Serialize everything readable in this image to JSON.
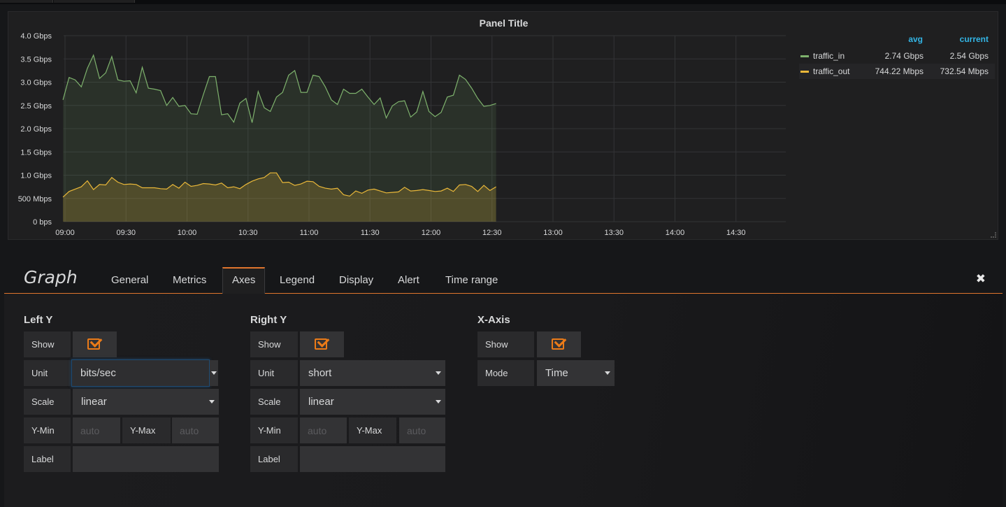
{
  "panel": {
    "title": "Panel Title",
    "legend": {
      "headers": {
        "avg": "avg",
        "current": "current"
      },
      "rows": [
        {
          "name": "traffic_in",
          "avg": "2.74 Gbps",
          "current": "2.54 Gbps",
          "color": "#7eb26d"
        },
        {
          "name": "traffic_out",
          "avg": "744.22 Mbps",
          "current": "732.54 Mbps",
          "color": "#eab839"
        }
      ]
    }
  },
  "chart_data": {
    "type": "area",
    "title": "Panel Title",
    "y_tick_labels": [
      "0 bps",
      "500 Mbps",
      "1.0 Gbps",
      "1.5 Gbps",
      "2.0 Gbps",
      "2.5 Gbps",
      "3.0 Gbps",
      "3.5 Gbps",
      "4.0 Gbps"
    ],
    "x_tick_labels": [
      "09:00",
      "09:30",
      "10:00",
      "10:30",
      "11:00",
      "11:30",
      "12:00",
      "12:30",
      "13:00",
      "13:30",
      "14:00",
      "14:30"
    ],
    "ylim_gbps": [
      0,
      4
    ],
    "x_range_minutes_after_0900": [
      -1,
      178
    ],
    "grid": true,
    "legend_position": "right",
    "series": [
      {
        "name": "traffic_in",
        "color": "#7eb26d",
        "points": [
          [
            -1,
            2.62
          ],
          [
            2,
            3.1
          ],
          [
            5,
            3.05
          ],
          [
            8,
            2.9
          ],
          [
            11,
            3.3
          ],
          [
            14,
            3.58
          ],
          [
            17,
            3.08
          ],
          [
            20,
            3.2
          ],
          [
            23,
            3.55
          ],
          [
            26,
            3.05
          ],
          [
            29,
            3.02
          ],
          [
            32,
            3.03
          ],
          [
            35,
            2.77
          ],
          [
            38,
            3.32
          ],
          [
            41,
            2.87
          ],
          [
            44,
            2.85
          ],
          [
            47,
            2.82
          ],
          [
            50,
            2.5
          ],
          [
            53,
            2.67
          ],
          [
            56,
            2.48
          ],
          [
            59,
            2.5
          ],
          [
            62,
            2.32
          ],
          [
            65,
            2.31
          ],
          [
            68,
            2.73
          ],
          [
            71,
            3.12
          ],
          [
            74,
            3.12
          ],
          [
            77,
            2.3
          ],
          [
            80,
            2.32
          ],
          [
            83,
            2.14
          ],
          [
            86,
            2.55
          ],
          [
            89,
            2.65
          ],
          [
            92,
            2.13
          ],
          [
            95,
            2.8
          ],
          [
            98,
            2.45
          ],
          [
            101,
            2.37
          ],
          [
            104,
            2.68
          ],
          [
            107,
            2.78
          ],
          [
            110,
            3.15
          ],
          [
            113,
            3.25
          ],
          [
            116,
            2.78
          ],
          [
            119,
            2.78
          ],
          [
            122,
            3.15
          ],
          [
            125,
            3.12
          ],
          [
            128,
            2.9
          ],
          [
            131,
            2.62
          ],
          [
            134,
            2.52
          ],
          [
            137,
            2.85
          ],
          [
            140,
            2.76
          ],
          [
            143,
            2.76
          ],
          [
            146,
            2.85
          ],
          [
            149,
            2.68
          ],
          [
            152,
            2.52
          ],
          [
            155,
            2.66
          ],
          [
            158,
            2.23
          ],
          [
            161,
            2.49
          ],
          [
            164,
            2.58
          ],
          [
            167,
            2.6
          ],
          [
            170,
            2.25
          ],
          [
            173,
            2.36
          ],
          [
            176,
            2.8
          ],
          [
            179,
            2.37
          ],
          [
            182,
            2.26
          ],
          [
            185,
            2.35
          ],
          [
            188,
            2.68
          ],
          [
            191,
            2.72
          ],
          [
            194,
            3.15
          ],
          [
            197,
            3.06
          ],
          [
            200,
            2.87
          ],
          [
            203,
            2.65
          ],
          [
            206,
            2.48
          ],
          [
            209,
            2.5
          ],
          [
            212,
            2.54
          ]
        ]
      },
      {
        "name": "traffic_out",
        "color": "#eab839",
        "points": [
          [
            -1,
            0.53
          ],
          [
            2,
            0.65
          ],
          [
            5,
            0.7
          ],
          [
            8,
            0.75
          ],
          [
            11,
            0.88
          ],
          [
            14,
            0.69
          ],
          [
            17,
            0.8
          ],
          [
            20,
            0.79
          ],
          [
            23,
            0.95
          ],
          [
            26,
            0.85
          ],
          [
            29,
            0.8
          ],
          [
            32,
            0.81
          ],
          [
            35,
            0.8
          ],
          [
            38,
            0.73
          ],
          [
            41,
            0.73
          ],
          [
            44,
            0.73
          ],
          [
            47,
            0.71
          ],
          [
            50,
            0.7
          ],
          [
            53,
            0.8
          ],
          [
            56,
            0.72
          ],
          [
            59,
            0.85
          ],
          [
            62,
            0.76
          ],
          [
            65,
            0.78
          ],
          [
            68,
            0.82
          ],
          [
            71,
            0.81
          ],
          [
            74,
            0.79
          ],
          [
            77,
            0.83
          ],
          [
            80,
            0.73
          ],
          [
            83,
            0.75
          ],
          [
            86,
            0.71
          ],
          [
            89,
            0.8
          ],
          [
            92,
            0.87
          ],
          [
            95,
            0.92
          ],
          [
            98,
            0.95
          ],
          [
            101,
            1.05
          ],
          [
            104,
            1.05
          ],
          [
            107,
            0.84
          ],
          [
            110,
            0.85
          ],
          [
            113,
            0.78
          ],
          [
            116,
            0.81
          ],
          [
            119,
            0.87
          ],
          [
            122,
            0.86
          ],
          [
            125,
            0.76
          ],
          [
            128,
            0.72
          ],
          [
            131,
            0.7
          ],
          [
            134,
            0.72
          ],
          [
            137,
            0.58
          ],
          [
            140,
            0.55
          ],
          [
            143,
            0.66
          ],
          [
            146,
            0.61
          ],
          [
            149,
            0.68
          ],
          [
            152,
            0.7
          ],
          [
            155,
            0.66
          ],
          [
            158,
            0.62
          ],
          [
            161,
            0.63
          ],
          [
            164,
            0.64
          ],
          [
            167,
            0.74
          ],
          [
            170,
            0.66
          ],
          [
            173,
            0.67
          ],
          [
            176,
            0.69
          ],
          [
            179,
            0.67
          ],
          [
            182,
            0.65
          ],
          [
            185,
            0.66
          ],
          [
            188,
            0.72
          ],
          [
            191,
            0.65
          ],
          [
            194,
            0.79
          ],
          [
            197,
            0.8
          ],
          [
            200,
            0.76
          ],
          [
            203,
            0.65
          ],
          [
            206,
            0.78
          ],
          [
            209,
            0.67
          ],
          [
            212,
            0.75
          ]
        ]
      }
    ]
  },
  "editor": {
    "title": "Graph",
    "tabs": [
      "General",
      "Metrics",
      "Axes",
      "Legend",
      "Display",
      "Alert",
      "Time range"
    ],
    "active_tab": "Axes",
    "close_icon": "close-icon",
    "left_y": {
      "title": "Left Y",
      "show_label": "Show",
      "show": true,
      "unit_label": "Unit",
      "unit": "bits/sec",
      "scale_label": "Scale",
      "scale": "linear",
      "ymin_label": "Y-Min",
      "ymin_placeholder": "auto",
      "ymax_label": "Y-Max",
      "ymax_placeholder": "auto",
      "label_label": "Label",
      "label_value": ""
    },
    "right_y": {
      "title": "Right Y",
      "show_label": "Show",
      "show": true,
      "unit_label": "Unit",
      "unit": "short",
      "scale_label": "Scale",
      "scale": "linear",
      "ymin_label": "Y-Min",
      "ymin_placeholder": "auto",
      "ymax_label": "Y-Max",
      "ymax_placeholder": "auto",
      "label_label": "Label",
      "label_value": ""
    },
    "x_axis": {
      "title": "X-Axis",
      "show_label": "Show",
      "show": true,
      "mode_label": "Mode",
      "mode": "Time"
    }
  }
}
